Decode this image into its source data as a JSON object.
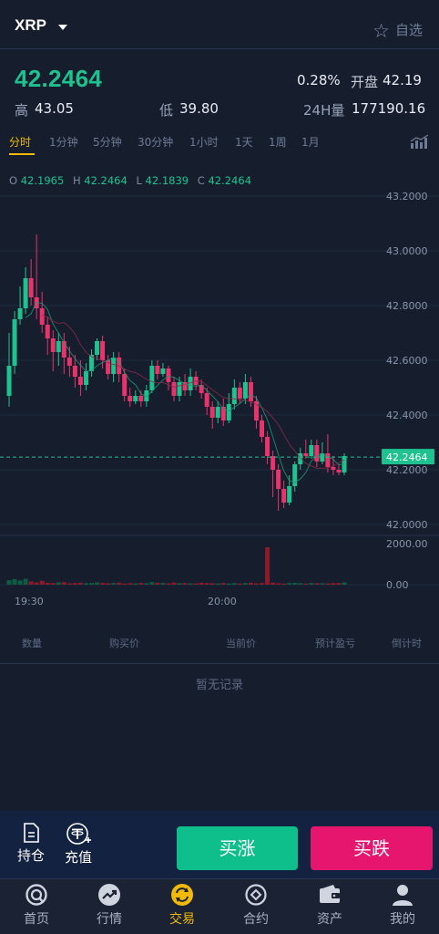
{
  "header": {
    "pair": "XRP",
    "favorite_label": "自选"
  },
  "ticker": {
    "price": "42.2464",
    "change": "0.28%",
    "open_label": "开盘",
    "open_value": "42.19",
    "high_label": "高",
    "high_value": "43.05",
    "low_label": "低",
    "low_value": "39.80",
    "vol_label": "24H量",
    "vol_value": "177190.16"
  },
  "intervals": [
    "分时",
    "1分钟",
    "5分钟",
    "30分钟",
    "1小时",
    "1天",
    "1周",
    "1月"
  ],
  "ohlc": {
    "o_label": "O",
    "o": "42.1965",
    "h_label": "H",
    "h": "42.2464",
    "l_label": "L",
    "l": "42.1839",
    "c_label": "C",
    "c": "42.2464"
  },
  "chart_data": {
    "type": "candlestick",
    "y_ticks": [
      "43.2000",
      "43.0000",
      "42.8000",
      "42.6000",
      "42.4000",
      "42.2000",
      "42.0000"
    ],
    "ylim": [
      42.0,
      43.2
    ],
    "current_price_label": "42.2464",
    "current_price": 42.2464,
    "volume_ticks": [
      "2000.00",
      "0.00"
    ],
    "x_ticks": [
      "19:30",
      "20:00"
    ],
    "up_color": "#1fc28f",
    "down_color": "#e8336b",
    "candles": [
      [
        42.47,
        42.58,
        42.7,
        42.43
      ],
      [
        42.58,
        42.75,
        42.78,
        42.55
      ],
      [
        42.75,
        42.79,
        42.87,
        42.73
      ],
      [
        42.79,
        42.9,
        42.94,
        42.77
      ],
      [
        42.9,
        42.83,
        42.97,
        42.8
      ],
      [
        42.83,
        42.79,
        43.06,
        42.75
      ],
      [
        42.79,
        42.73,
        42.85,
        42.7
      ],
      [
        42.73,
        42.68,
        42.76,
        42.62
      ],
      [
        42.68,
        42.63,
        42.71,
        42.56
      ],
      [
        42.63,
        42.67,
        42.7,
        42.58
      ],
      [
        42.67,
        42.61,
        42.7,
        42.55
      ],
      [
        42.61,
        42.58,
        42.65,
        42.54
      ],
      [
        42.58,
        42.54,
        42.62,
        42.5
      ],
      [
        42.54,
        42.51,
        42.6,
        42.47
      ],
      [
        42.51,
        42.56,
        42.59,
        42.49
      ],
      [
        42.56,
        42.62,
        42.64,
        42.54
      ],
      [
        42.62,
        42.67,
        42.68,
        42.6
      ],
      [
        42.67,
        42.6,
        42.69,
        42.57
      ],
      [
        42.6,
        42.55,
        42.62,
        42.53
      ],
      [
        42.55,
        42.61,
        42.63,
        42.52
      ],
      [
        42.61,
        42.55,
        42.63,
        42.52
      ],
      [
        42.55,
        42.47,
        42.57,
        42.45
      ],
      [
        42.47,
        42.45,
        42.5,
        42.43
      ],
      [
        42.45,
        42.47,
        42.49,
        42.44
      ],
      [
        42.47,
        42.45,
        42.49,
        42.43
      ],
      [
        42.45,
        42.49,
        42.51,
        42.43
      ],
      [
        42.49,
        42.58,
        42.6,
        42.48
      ],
      [
        42.58,
        42.55,
        42.6,
        42.53
      ],
      [
        42.55,
        42.57,
        42.59,
        42.54
      ],
      [
        42.57,
        42.52,
        42.58,
        42.49
      ],
      [
        42.52,
        42.47,
        42.54,
        42.45
      ],
      [
        42.47,
        42.52,
        42.54,
        42.45
      ],
      [
        42.52,
        42.49,
        42.55,
        42.47
      ],
      [
        42.49,
        42.54,
        42.57,
        42.47
      ],
      [
        42.54,
        42.51,
        42.56,
        42.49
      ],
      [
        42.51,
        42.48,
        42.53,
        42.46
      ],
      [
        42.48,
        42.43,
        42.5,
        42.4
      ],
      [
        42.43,
        42.39,
        42.45,
        42.35
      ],
      [
        42.39,
        42.43,
        42.45,
        42.37
      ],
      [
        42.43,
        42.38,
        42.46,
        42.36
      ],
      [
        42.38,
        42.44,
        42.48,
        42.37
      ],
      [
        42.44,
        42.5,
        42.53,
        42.42
      ],
      [
        42.5,
        42.46,
        42.52,
        42.44
      ],
      [
        42.46,
        42.52,
        42.55,
        42.44
      ],
      [
        42.52,
        42.45,
        42.54,
        42.43
      ],
      [
        42.45,
        42.38,
        42.47,
        42.35
      ],
      [
        42.38,
        42.32,
        42.4,
        42.3
      ],
      [
        42.32,
        42.25,
        42.34,
        42.22
      ],
      [
        42.25,
        42.2,
        42.27,
        42.1
      ],
      [
        42.2,
        42.13,
        42.22,
        42.05
      ],
      [
        42.13,
        42.08,
        42.16,
        42.06
      ],
      [
        42.08,
        42.14,
        42.18,
        42.07
      ],
      [
        42.14,
        42.22,
        42.23,
        42.12
      ],
      [
        42.22,
        42.26,
        42.28,
        42.2
      ],
      [
        42.26,
        42.25,
        42.31,
        42.24
      ],
      [
        42.25,
        42.29,
        42.31,
        42.24
      ],
      [
        42.29,
        42.23,
        42.31,
        42.21
      ],
      [
        42.23,
        42.26,
        42.3,
        42.22
      ],
      [
        42.26,
        42.21,
        42.33,
        42.19
      ],
      [
        42.21,
        42.2,
        42.25,
        42.18
      ],
      [
        42.2,
        42.19,
        42.22,
        42.18
      ],
      [
        42.19,
        42.25,
        42.26,
        42.18
      ]
    ],
    "volumes": [
      160,
      200,
      150,
      210,
      120,
      80,
      140,
      70,
      60,
      80,
      90,
      50,
      60,
      70,
      55,
      60,
      80,
      65,
      50,
      60,
      70,
      40,
      55,
      45,
      60,
      50,
      90,
      70,
      60,
      50,
      80,
      55,
      60,
      50,
      45,
      70,
      60,
      50,
      45,
      60,
      40,
      55,
      45,
      60,
      70,
      50,
      60,
      1350,
      75,
      55,
      40,
      60,
      70,
      55,
      40,
      60,
      55,
      50,
      45,
      55,
      60,
      80
    ]
  },
  "table_header": {
    "qty": "数量",
    "buy_price": "购买价",
    "cur_price": "当前价",
    "pnl": "预计盈亏",
    "countdown": "倒计时"
  },
  "empty_text": "暂无记录",
  "actions": {
    "positions": "持仓",
    "deposit": "充值",
    "buy_up": "买涨",
    "buy_down": "买跌"
  },
  "tabs": [
    {
      "label": "首页",
      "icon": "home-icon"
    },
    {
      "label": "行情",
      "icon": "market-icon"
    },
    {
      "label": "交易",
      "icon": "trade-icon"
    },
    {
      "label": "合约",
      "icon": "contract-icon"
    },
    {
      "label": "资产",
      "icon": "wallet-icon"
    },
    {
      "label": "我的",
      "icon": "profile-icon"
    }
  ]
}
